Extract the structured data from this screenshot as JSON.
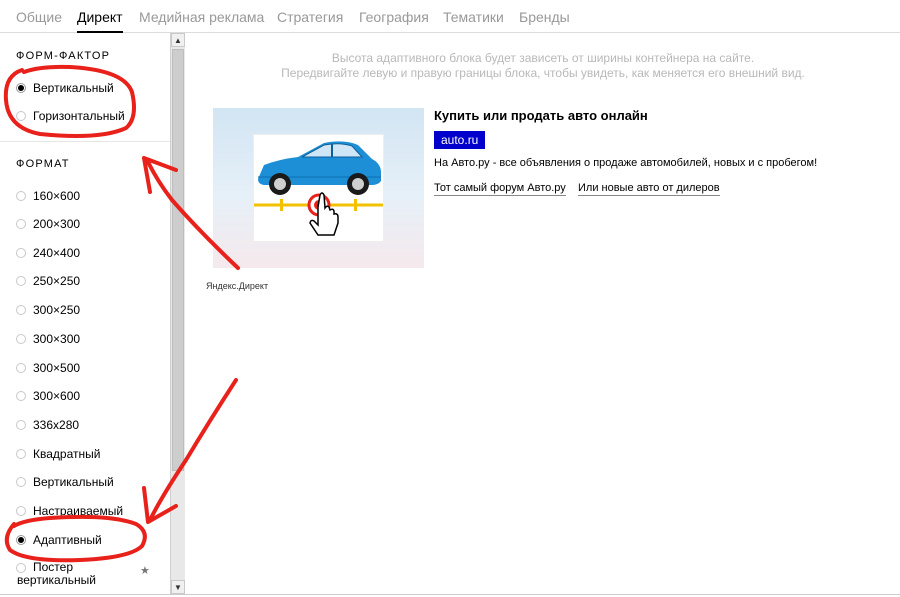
{
  "tabs": [
    {
      "label": "Общие",
      "active": false
    },
    {
      "label": "Директ",
      "active": true
    },
    {
      "label": "Медийная реклама",
      "active": false
    },
    {
      "label": "Стратегия",
      "active": false
    },
    {
      "label": "География",
      "active": false
    },
    {
      "label": "Тематики",
      "active": false
    },
    {
      "label": "Бренды",
      "active": false
    }
  ],
  "form_factor": {
    "title": "ФОРМ-ФАКТОР",
    "options": [
      {
        "label": "Вертикальный",
        "selected": true
      },
      {
        "label": "Горизонтальный",
        "selected": false
      }
    ]
  },
  "format": {
    "title": "ФОРМАТ",
    "options": [
      {
        "label": "160×600",
        "selected": false
      },
      {
        "label": "200×300",
        "selected": false
      },
      {
        "label": "240×400",
        "selected": false
      },
      {
        "label": "250×250",
        "selected": false
      },
      {
        "label": "300×250",
        "selected": false
      },
      {
        "label": "300×300",
        "selected": false
      },
      {
        "label": "300×500",
        "selected": false
      },
      {
        "label": "300×600",
        "selected": false
      },
      {
        "label": "336x280",
        "selected": false
      },
      {
        "label": "Квадратный",
        "selected": false
      },
      {
        "label": "Вертикальный",
        "selected": false
      },
      {
        "label": "Настраиваемый",
        "selected": false
      },
      {
        "label": "Адаптивный",
        "selected": true
      },
      {
        "label": "Постер вертикальный",
        "line1": "Постер",
        "line2": "вертикальный",
        "selected": false
      }
    ],
    "star": "★"
  },
  "scrollbar": {
    "up": "▲",
    "down": "▼"
  },
  "preview": {
    "hint_line1": "Высота адаптивного блока будет зависеть от ширины контейнера на сайте.",
    "hint_line2": "Передвигайте левую и правую границы блока, чтобы увидеть, как меняется его внешний вид.",
    "source": "Яндекс.Директ",
    "ad_title": "Купить или продать авто онлайн",
    "ad_domain": "auto.ru",
    "ad_description": "На Авто.ру - все объявления о продаже автомобилей, новых и с пробегом!",
    "sitelinks": [
      "Тот самый форум Авто.ру",
      "Или новые авто от дилеров"
    ]
  },
  "colors": {
    "annotation": "#e8211b",
    "domain_badge": "#0000cc",
    "car_body": "#1d8fd6"
  }
}
